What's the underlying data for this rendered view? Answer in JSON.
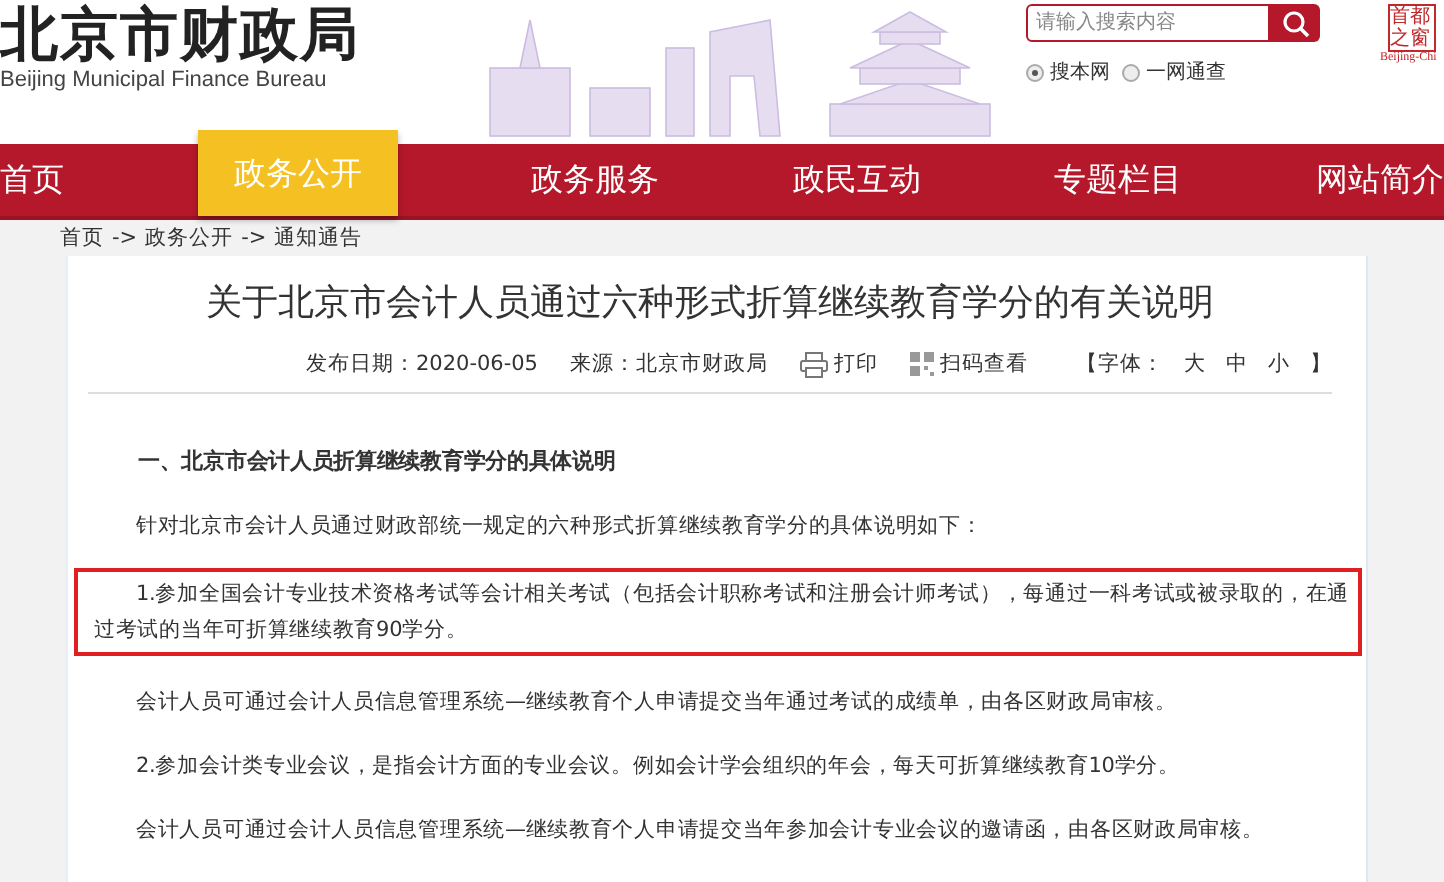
{
  "header": {
    "site_name": "北京市财政局",
    "site_name_en": "Beijing Municipal Finance Bureau",
    "search": {
      "placeholder": "请输入搜索内容",
      "scopes": [
        {
          "label": "搜本网",
          "selected": true
        },
        {
          "label": "一网通查",
          "selected": false
        }
      ]
    },
    "portal_logo": {
      "seal_text": "首都之窗",
      "caption": "Beijing-Chi"
    }
  },
  "nav": [
    {
      "label": "首页",
      "selected": false
    },
    {
      "label": "政务公开",
      "selected": true
    },
    {
      "label": "政务服务",
      "selected": false
    },
    {
      "label": "政民互动",
      "selected": false
    },
    {
      "label": "专题栏目",
      "selected": false
    },
    {
      "label": "网站简介",
      "selected": false
    }
  ],
  "breadcrumb": [
    "首页",
    "->",
    "政务公开",
    "->",
    "通知通告"
  ],
  "article": {
    "title": "关于北京市会计人员通过六种形式折算继续教育学分的有关说明",
    "meta": {
      "date": "发布日期：2020-06-05",
      "source": "来源：北京市财政局",
      "print": "打印",
      "scan": "扫码查看",
      "font_open": "【字体：",
      "font_sizes": [
        "大",
        "中",
        "小"
      ],
      "font_close": "】"
    },
    "blocks": [
      {
        "kind": "heading",
        "text": "一、北京市会计人员折算继续教育学分的具体说明",
        "highlighted": false
      },
      {
        "kind": "paragraph",
        "text": "针对北京市会计人员通过财政部统一规定的六种形式折算继续教育学分的具体说明如下：",
        "highlighted": false
      },
      {
        "kind": "paragraph",
        "text": "1.参加全国会计专业技术资格考试等会计相关考试（包括会计职称考试和注册会计师考试），每通过一科考试或被录取的，在通过考试的当年可折算继续教育90学分。",
        "highlighted": true
      },
      {
        "kind": "paragraph",
        "text": "会计人员可通过会计人员信息管理系统—继续教育个人申请提交当年通过考试的成绩单，由各区财政局审核。",
        "highlighted": false
      },
      {
        "kind": "paragraph",
        "text": "2.参加会计类专业会议，是指会计方面的专业会议。例如会计学会组织的年会，每天可折算继续教育10学分。",
        "highlighted": false
      },
      {
        "kind": "paragraph",
        "text": "会计人员可通过会计人员信息管理系统—继续教育个人申请提交当年参加会计专业会议的邀请函，由各区财政局审核。",
        "highlighted": false
      }
    ]
  }
}
